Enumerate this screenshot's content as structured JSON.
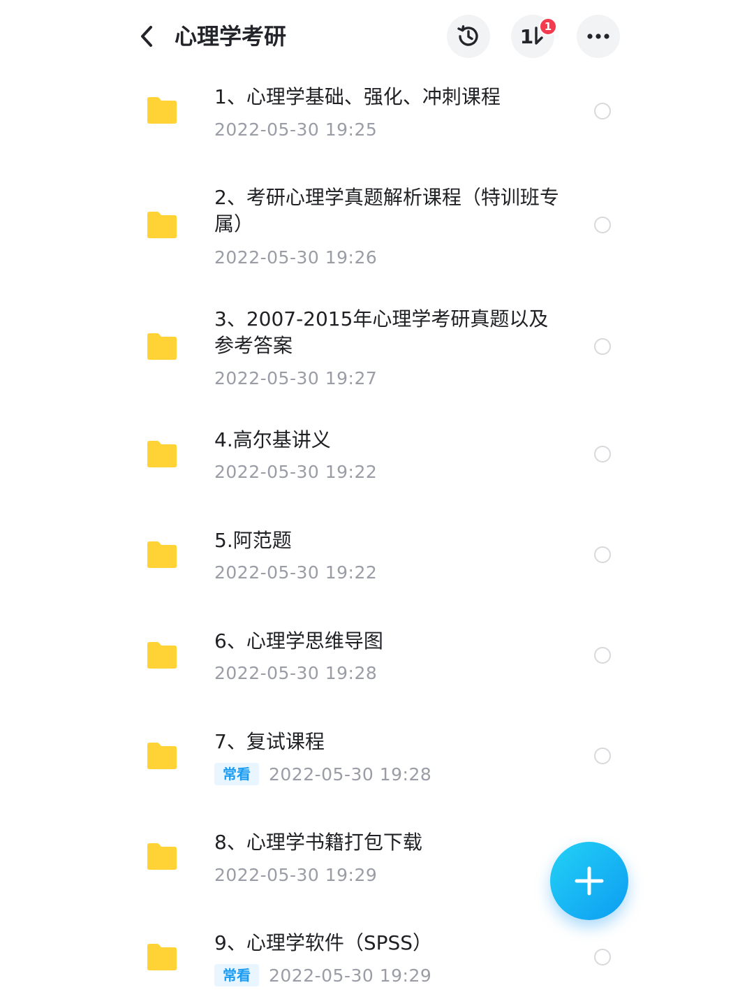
{
  "header": {
    "title": "心理学考研",
    "sort_label": "1",
    "notification_count": "1"
  },
  "icons": {
    "back": "chevron-left-icon",
    "history": "history-clock-icon",
    "sort": "sort-icon",
    "more": "more-horizontal-icon",
    "folder": "folder-icon",
    "add": "plus-icon"
  },
  "colors": {
    "folder": "#ffd335",
    "accent": "#0d9cf2",
    "badge": "#f43a4e",
    "tag_text": "#1a9cf0"
  },
  "items": [
    {
      "name": "1、心理学基础、强化、冲刺课程",
      "time": "2022-05-30  19:25",
      "tag": ""
    },
    {
      "name": "2、考研心理学真题解析课程（特训班专属）",
      "time": "2022-05-30  19:26",
      "tag": ""
    },
    {
      "name": "3、2007-2015年心理学考研真题以及参考答案",
      "time": "2022-05-30  19:27",
      "tag": ""
    },
    {
      "name": "4.高尔基讲义",
      "time": "2022-05-30  19:22",
      "tag": ""
    },
    {
      "name": "5.阿范题",
      "time": "2022-05-30  19:22",
      "tag": ""
    },
    {
      "name": "6、心理学思维导图",
      "time": "2022-05-30  19:28",
      "tag": ""
    },
    {
      "name": "7、复试课程",
      "time": "2022-05-30  19:28",
      "tag": "常看"
    },
    {
      "name": "8、心理学书籍打包下载",
      "time": "2022-05-30  19:29",
      "tag": ""
    },
    {
      "name": "9、心理学软件（SPSS）",
      "time": "2022-05-30  19:29",
      "tag": "常看"
    }
  ]
}
